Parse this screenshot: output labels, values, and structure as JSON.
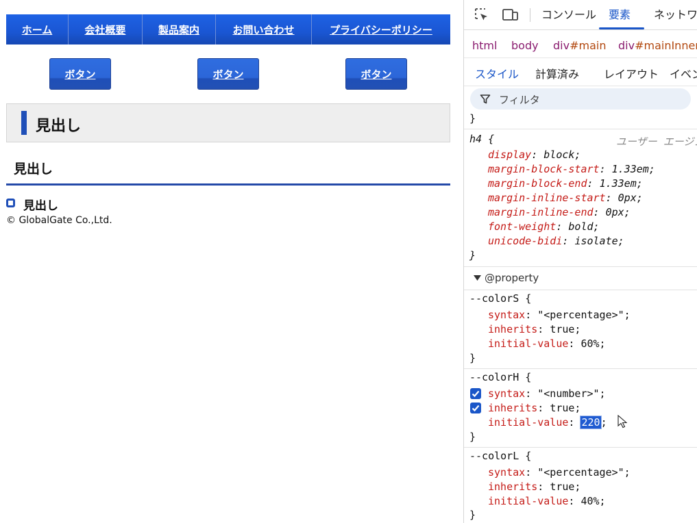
{
  "nav": {
    "items": [
      {
        "label": "ホーム"
      },
      {
        "label": "会社概要"
      },
      {
        "label": "製品案内"
      },
      {
        "label": "お問い合わせ"
      },
      {
        "label": "プライバシーポリシー"
      }
    ]
  },
  "buttons": [
    {
      "label": "ボタン"
    },
    {
      "label": "ボタン"
    },
    {
      "label": "ボタン"
    }
  ],
  "headings": {
    "h1": "見出し",
    "h2": "見出し",
    "h3": "見出し"
  },
  "footer": {
    "copyright": "© GlobalGate Co.,Ltd."
  },
  "devtools": {
    "tabs": {
      "console": "コンソール",
      "elements": "要素",
      "network": "ネットワーク"
    },
    "breadcrumbs": {
      "html": "html",
      "body": "body",
      "main_tag": "div",
      "main_id": "#main",
      "inner_tag": "div",
      "inner_id": "#mainInner"
    },
    "subtabs": {
      "styles": "スタイル",
      "computed": "計算済み",
      "layout": "レイアウト",
      "events": "イベント"
    },
    "filter_placeholder": "フィルタ",
    "prev_brace": "}",
    "h4_rule": {
      "selector": "h4 {",
      "origin": "ユーザー エージェント",
      "decls": [
        {
          "p": "display",
          "v": "block;"
        },
        {
          "p": "margin-block-start",
          "v": "1.33em;"
        },
        {
          "p": "margin-block-end",
          "v": "1.33em;"
        },
        {
          "p": "margin-inline-start",
          "v": "0px;"
        },
        {
          "p": "margin-inline-end",
          "v": "0px;"
        },
        {
          "p": "font-weight",
          "v": "bold;"
        },
        {
          "p": "unicode-bidi",
          "v": "isolate;"
        }
      ],
      "close": "}"
    },
    "property_section": "@property",
    "props": [
      {
        "name": "--colorS {",
        "syntax": "\"<percentage>\";",
        "inherits": "true;",
        "initial": "60%;",
        "close": "}"
      },
      {
        "name": "--colorH {",
        "syntax": "\"<number>\";",
        "inherits": "true;",
        "initial": "220",
        "initial_tail": ";",
        "close": "}"
      },
      {
        "name": "--colorL {",
        "syntax": "\"<percentage>\";",
        "inherits": "true;",
        "initial": "40%;",
        "close": "}"
      }
    ],
    "decl_names": {
      "syntax": "syntax",
      "inherits": "inherits",
      "initial": "initial-value"
    }
  },
  "colors": {
    "nav_blue": "#1a56d3",
    "accent": "#1f4fb8",
    "devtools_active": "#1a56c8",
    "prop_red": "#c41a16"
  }
}
